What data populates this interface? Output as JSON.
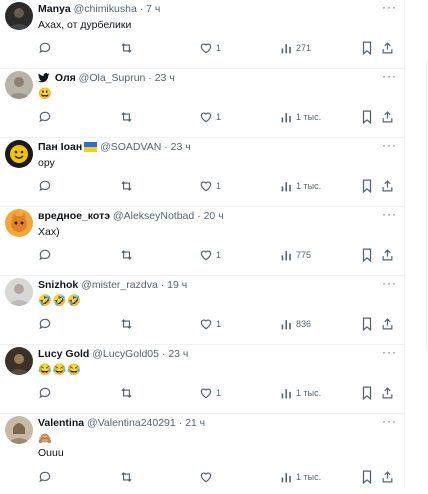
{
  "tweets": [
    {
      "name": "Manya",
      "handle": "@chimikusha",
      "time": "7 ч",
      "text": "Ахах, от дурбелики",
      "likes": "1",
      "views": "271",
      "avatar": "dark"
    },
    {
      "name": "Оля",
      "handle": "@Ola_Suprun",
      "time": "23 ч",
      "text": "😃",
      "likes": "1",
      "views": "1 тыс.",
      "avatar": "gray",
      "prefix": "bird"
    },
    {
      "name": "Пан Іоан",
      "handle": "@SOADVAN",
      "time": "23 ч",
      "text": "ору",
      "likes": "1",
      "views": "1 тыс.",
      "avatar": "smiley",
      "flag": "ua"
    },
    {
      "name": "вредное_котэ",
      "handle": "@AlekseyNotbad",
      "time": "20 ч",
      "text": "Хах)",
      "likes": "1",
      "views": "775",
      "avatar": "cat"
    },
    {
      "name": "Snizhok",
      "handle": "@mister_razdva",
      "time": "19 ч",
      "text": "🤣🤣🤣",
      "likes": "1",
      "views": "836",
      "avatar": "photo"
    },
    {
      "name": "Lucy Gold",
      "handle": "@LucyGold05",
      "time": "23 ч",
      "text": "😂😂😂",
      "likes": "1",
      "views": "1 тыс.",
      "avatar": "dark2"
    },
    {
      "name": "Valentina",
      "handle": "@Valentina240291",
      "time": "21 ч",
      "text": "🙈",
      "text2": "Ouuu",
      "likes": "",
      "views": "1 тыс.",
      "avatar": "woman"
    }
  ],
  "separator": "·",
  "more": "···",
  "colors": {
    "text": "#0f1419",
    "muted": "#536471",
    "border": "#eff3f4"
  }
}
